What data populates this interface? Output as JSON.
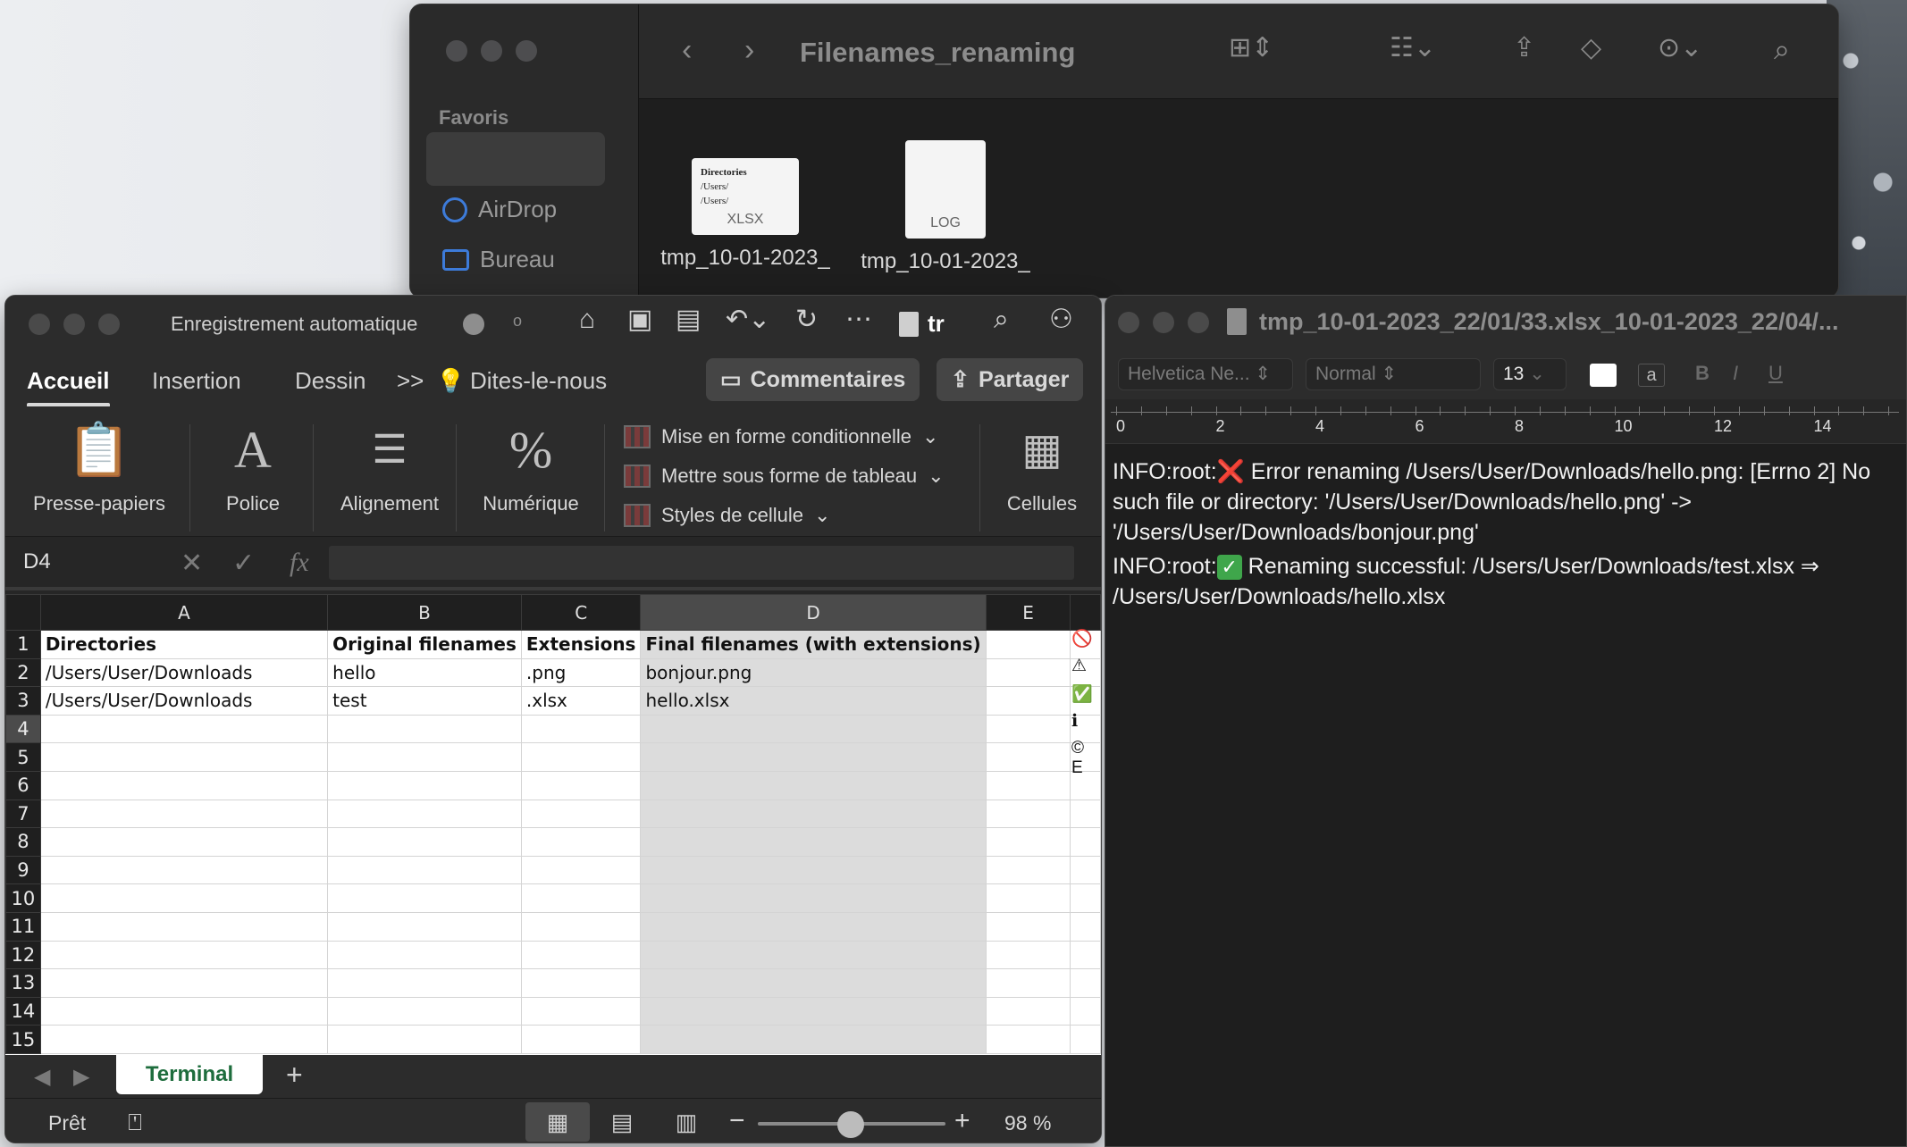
{
  "finder": {
    "title": "Filenames_renaming",
    "sidebar_heading": "Favoris",
    "sidebar_items": [
      "AirDrop",
      "Bureau"
    ],
    "files": [
      {
        "name": "tmp_10-01-2023_",
        "type": "XLSX",
        "preview_lines": [
          "Directories",
          "/Users/",
          "/Users/"
        ]
      },
      {
        "name": "tmp_10-01-2023_",
        "type": "LOG"
      }
    ]
  },
  "excel": {
    "autosave_label": "Enregistrement automatique",
    "autosave_state": "o",
    "doc_label": "tr",
    "tabs": [
      "Accueil",
      "Insertion",
      "Dessin",
      "Dites-le-nous"
    ],
    "more_label": ">>",
    "comments_button": "Commentaires",
    "share_button": "Partager",
    "ribbon": {
      "clipboard": "Presse-papiers",
      "font": "Police",
      "font_glyph": "A",
      "alignment": "Alignement",
      "number": "Numérique",
      "number_glyph": "%",
      "conditional_format": "Mise en forme conditionnelle",
      "format_as_table": "Mettre sous forme de tableau",
      "cell_styles": "Styles de cellule",
      "cells": "Cellules"
    },
    "name_box": "D4",
    "fx": "fx",
    "columns": [
      "A",
      "B",
      "C",
      "D",
      "E"
    ],
    "selected_column": "D",
    "selected_row": "4",
    "rows": [
      {
        "n": "1",
        "cells": [
          "Directories",
          "Original filenames",
          "Extensions",
          "Final filenames (with extensions)",
          ""
        ]
      },
      {
        "n": "2",
        "cells": [
          "/Users/User/Downloads",
          "hello",
          ".png",
          "bonjour.png",
          ""
        ]
      },
      {
        "n": "3",
        "cells": [
          "/Users/User/Downloads",
          "test",
          ".xlsx",
          "hello.xlsx",
          ""
        ]
      },
      {
        "n": "4",
        "cells": [
          "",
          "",
          "",
          "",
          ""
        ]
      },
      {
        "n": "5",
        "cells": [
          "",
          "",
          "",
          "",
          ""
        ]
      },
      {
        "n": "6",
        "cells": [
          "",
          "",
          "",
          "",
          ""
        ]
      },
      {
        "n": "7",
        "cells": [
          "",
          "",
          "",
          "",
          ""
        ]
      },
      {
        "n": "8",
        "cells": [
          "",
          "",
          "",
          "",
          ""
        ]
      },
      {
        "n": "9",
        "cells": [
          "",
          "",
          "",
          "",
          ""
        ]
      },
      {
        "n": "10",
        "cells": [
          "",
          "",
          "",
          "",
          ""
        ]
      },
      {
        "n": "11",
        "cells": [
          "",
          "",
          "",
          "",
          ""
        ]
      },
      {
        "n": "12",
        "cells": [
          "",
          "",
          "",
          "",
          ""
        ]
      },
      {
        "n": "13",
        "cells": [
          "",
          "",
          "",
          "",
          ""
        ]
      },
      {
        "n": "14",
        "cells": [
          "",
          "",
          "",
          "",
          ""
        ]
      },
      {
        "n": "15",
        "cells": [
          "",
          "",
          "",
          "",
          ""
        ]
      }
    ],
    "side_icons": [
      "🚫",
      "⚠",
      "✅",
      "ℹ",
      "© E"
    ],
    "sheet_tab": "Terminal",
    "add_sheet": "+",
    "status": "Prêt",
    "zoom": "98 %"
  },
  "textedit": {
    "title": "tmp_10-01-2023_22/01/33.xlsx_10-01-2023_22/04/...",
    "font_family": "Helvetica Ne...",
    "font_style": "Normal",
    "font_size": "13",
    "ruler_numbers": [
      "0",
      "2",
      "4",
      "6",
      "8",
      "10",
      "12",
      "14"
    ],
    "log": {
      "line1_prefix": "INFO:root:",
      "line1_emoji": "❌",
      "line1_text": " Error renaming /Users/User/Downloads/hello.png: [Errno 2] No such file or directory: '/Users/User/Downloads/hello.png' -> '/Users/User/Downloads/bonjour.png'",
      "line2_prefix": "INFO:root:",
      "line2_emoji": "✓",
      "line2_text": " Renaming successful: /Users/User/Downloads/test.xlsx ⇒ /Users/User/Downloads/hello.xlsx"
    }
  }
}
